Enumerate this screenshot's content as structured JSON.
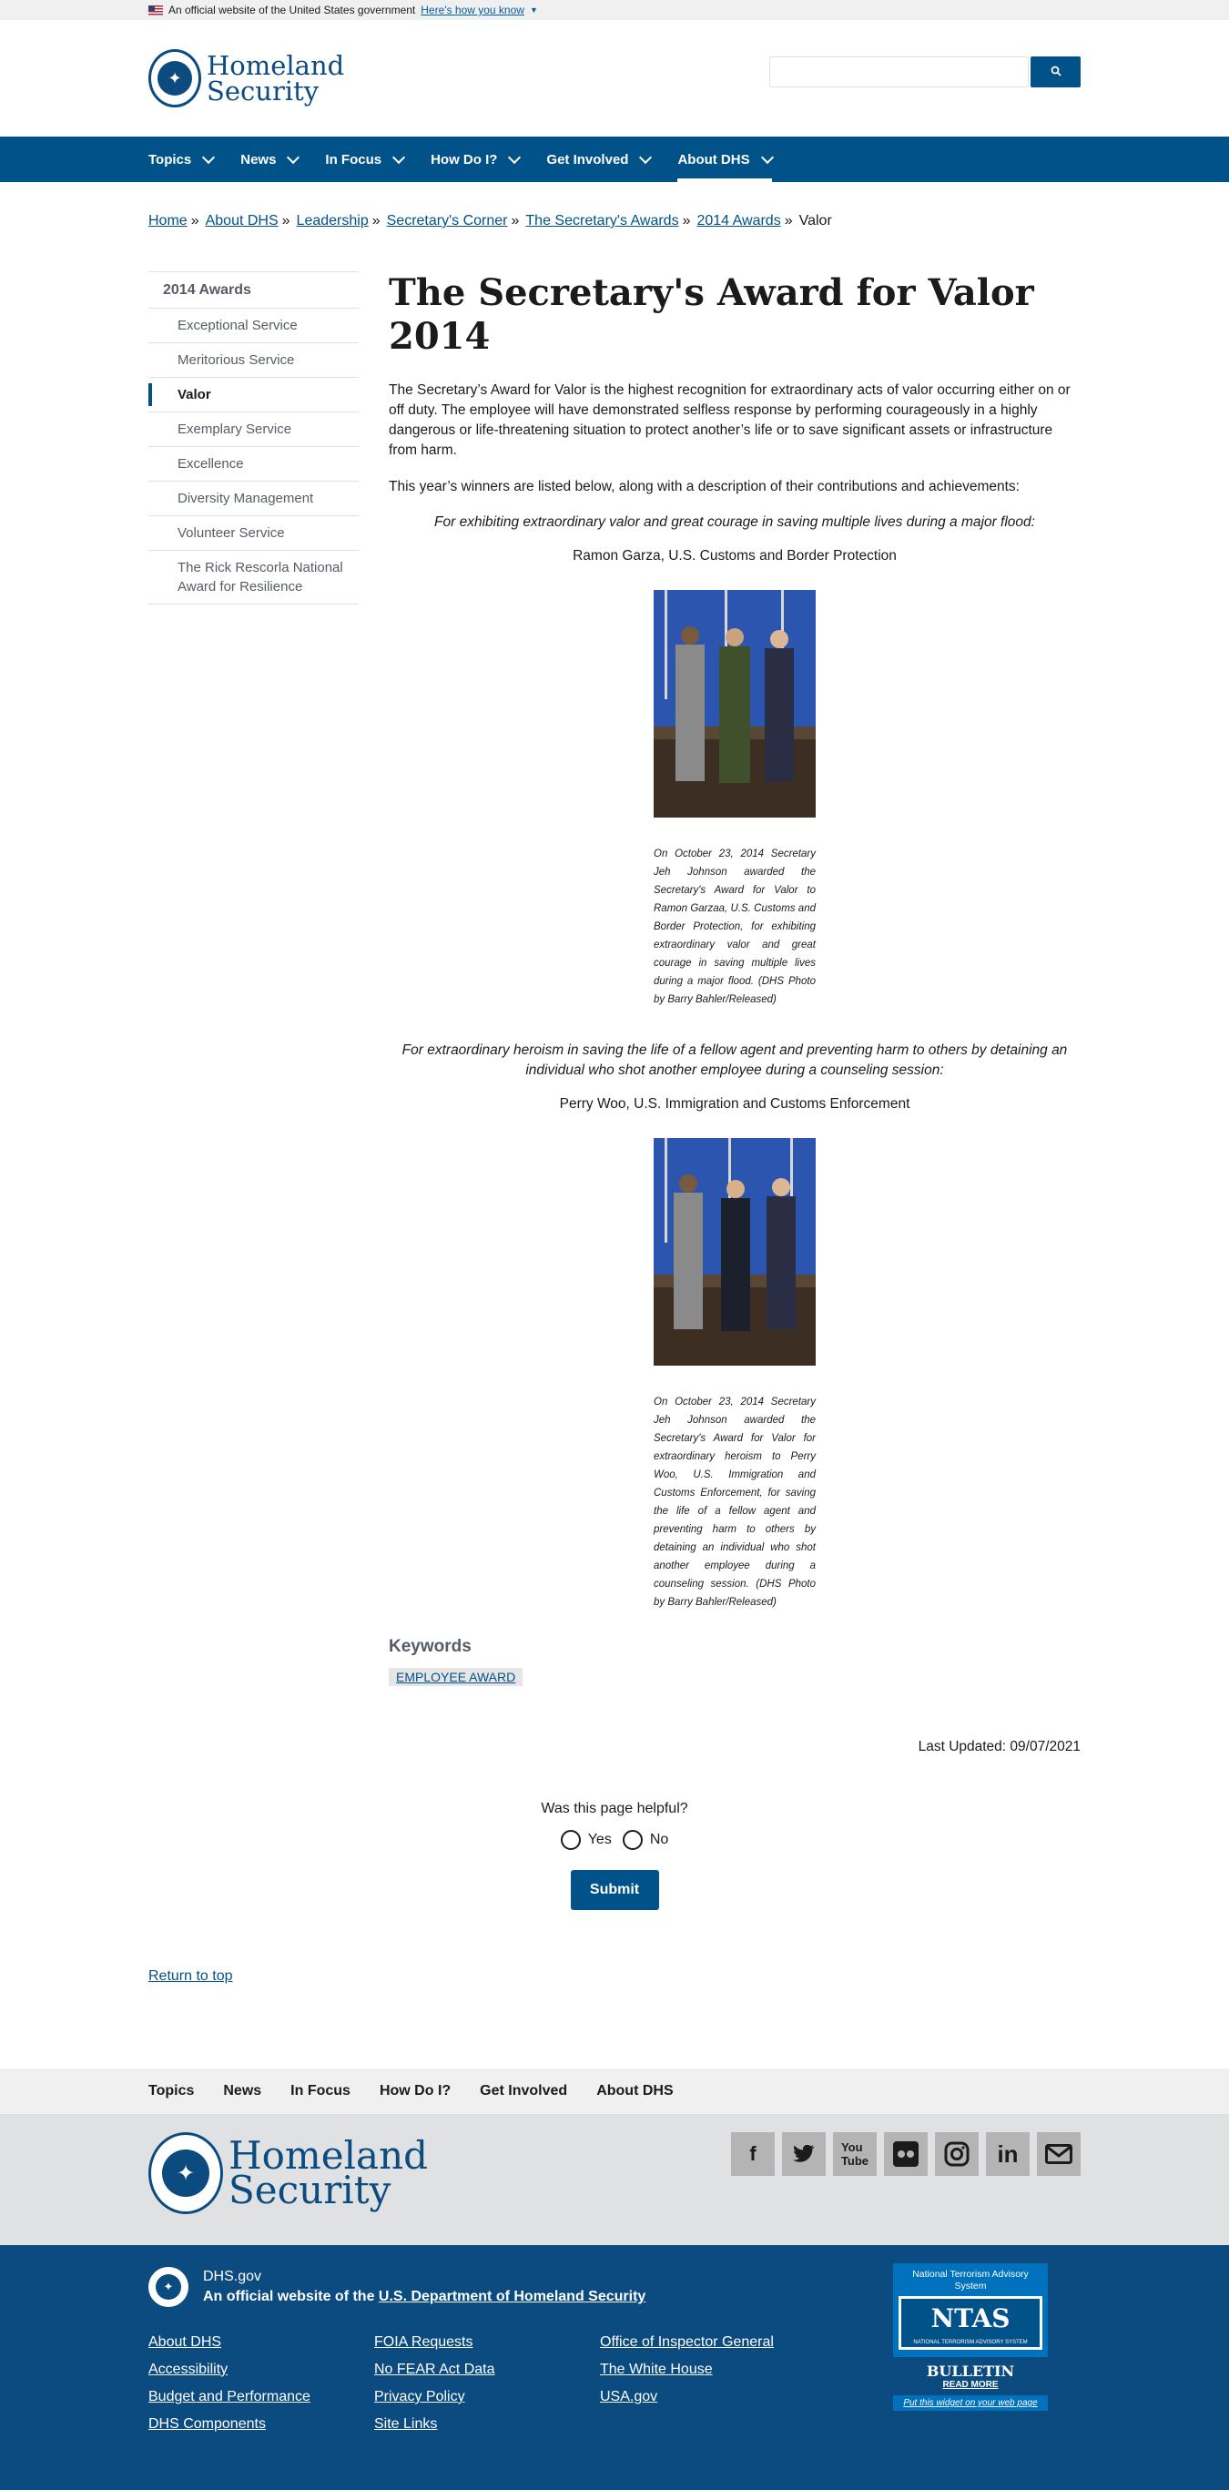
{
  "banner": {
    "text": "An official website of the United States government",
    "link": "Here's how you know"
  },
  "header": {
    "logo_line1": "Homeland",
    "logo_line2": "Security",
    "search_placeholder": "",
    "search_icon": "search-icon"
  },
  "nav": {
    "items": [
      {
        "label": "Topics"
      },
      {
        "label": "News"
      },
      {
        "label": "In Focus"
      },
      {
        "label": "How Do I?"
      },
      {
        "label": "Get Involved"
      },
      {
        "label": "About DHS"
      }
    ],
    "active": "About DHS"
  },
  "breadcrumb": {
    "items": [
      "Home",
      "About DHS",
      "Leadership",
      "Secretary's Corner",
      "The Secretary's Awards",
      "2014 Awards"
    ],
    "current": "Valor",
    "separator": "»"
  },
  "sidenav": {
    "title": "2014 Awards",
    "items": [
      {
        "label": "Exceptional Service"
      },
      {
        "label": "Meritorious Service"
      },
      {
        "label": "Valor"
      },
      {
        "label": "Exemplary Service"
      },
      {
        "label": "Excellence"
      },
      {
        "label": "Diversity Management"
      },
      {
        "label": "Volunteer Service"
      },
      {
        "label": "The Rick Rescorla National Award for Resilience"
      }
    ],
    "current": "Valor"
  },
  "main": {
    "title": "The Secretary's Award for Valor 2014",
    "intro": "The Secretary’s Award for Valor is the highest recognition for extraordinary acts of valor occurring either on or off duty. The employee will have demonstrated selfless response by performing courageously in a highly dangerous or life-threatening situation to protect another’s life or to save significant assets or infrastructure from harm.",
    "winners_intro": "This year’s winners are listed below, along with a description of their contributions and achievements:",
    "awards": [
      {
        "citation": "For exhibiting extraordinary valor and great courage in saving multiple lives during a major flood:",
        "winner": "Ramon Garza, U.S. Customs and Border Protection",
        "caption": "On October 23, 2014 Secretary Jeh Johnson awarded the Secretary's Award for Valor to Ramon Garzaa, U.S. Customs and Border Protection, for exhibiting extraordinary valor and great courage in saving multiple lives during a major flood. (DHS Photo by Barry Bahler/Released)"
      },
      {
        "citation": "For extraordinary heroism in saving the life of a fellow agent and preventing harm to others by detaining an individual who shot another employee during a counseling session:",
        "winner": "Perry Woo, U.S. Immigration and Customs Enforcement",
        "caption": "On October 23, 2014 Secretary Jeh Johnson awarded the Secretary's Award for Valor for extraordinary heroism to Perry Woo, U.S. Immigration and Customs Enforcement, for saving the life of a fellow agent and preventing harm to others by detaining an individual who shot another employee during a counseling session. (DHS Photo by Barry Bahler/Released)"
      }
    ],
    "keywords_title": "Keywords",
    "keyword": "EMPLOYEE AWARD",
    "last_updated": "Last Updated: 09/07/2021"
  },
  "feedback": {
    "question": "Was this page helpful?",
    "yes": "Yes",
    "no": "No",
    "submit": "Submit"
  },
  "return_top": "Return to top",
  "footer_nav": [
    "Topics",
    "News",
    "In Focus",
    "How Do I?",
    "Get Involved",
    "About DHS"
  ],
  "footer_logo": {
    "line1": "Homeland",
    "line2": "Security"
  },
  "socials": [
    "facebook-icon",
    "twitter-icon",
    "youtube-icon",
    "flickr-icon",
    "instagram-icon",
    "linkedin-icon",
    "email-icon"
  ],
  "footer_bottom": {
    "domain": "DHS.gov",
    "official_prefix": "An official website of the ",
    "official_link": "U.S. Department of Homeland Security",
    "links_col1": [
      "About DHS",
      "Accessibility",
      "Budget and Performance",
      "DHS Components"
    ],
    "links_col2": [
      "FOIA Requests",
      "No FEAR Act Data",
      "Privacy Policy",
      "Site Links"
    ],
    "links_col3": [
      "Office of Inspector General",
      "The White House",
      "USA.gov"
    ]
  },
  "ntas": {
    "heading": "National Terrorism Advisory System",
    "logo": "NTAS",
    "logo_sub": "NATIONAL TERRORISM ADVISORY SYSTEM",
    "bulletin": "BULLETIN",
    "read_more": "READ MORE",
    "widget": "Put this widget on your web page"
  },
  "colors": {
    "brand_blue": "#005288",
    "dark_blue": "#0b4b80",
    "footer_gray": "#dfe1e2"
  }
}
